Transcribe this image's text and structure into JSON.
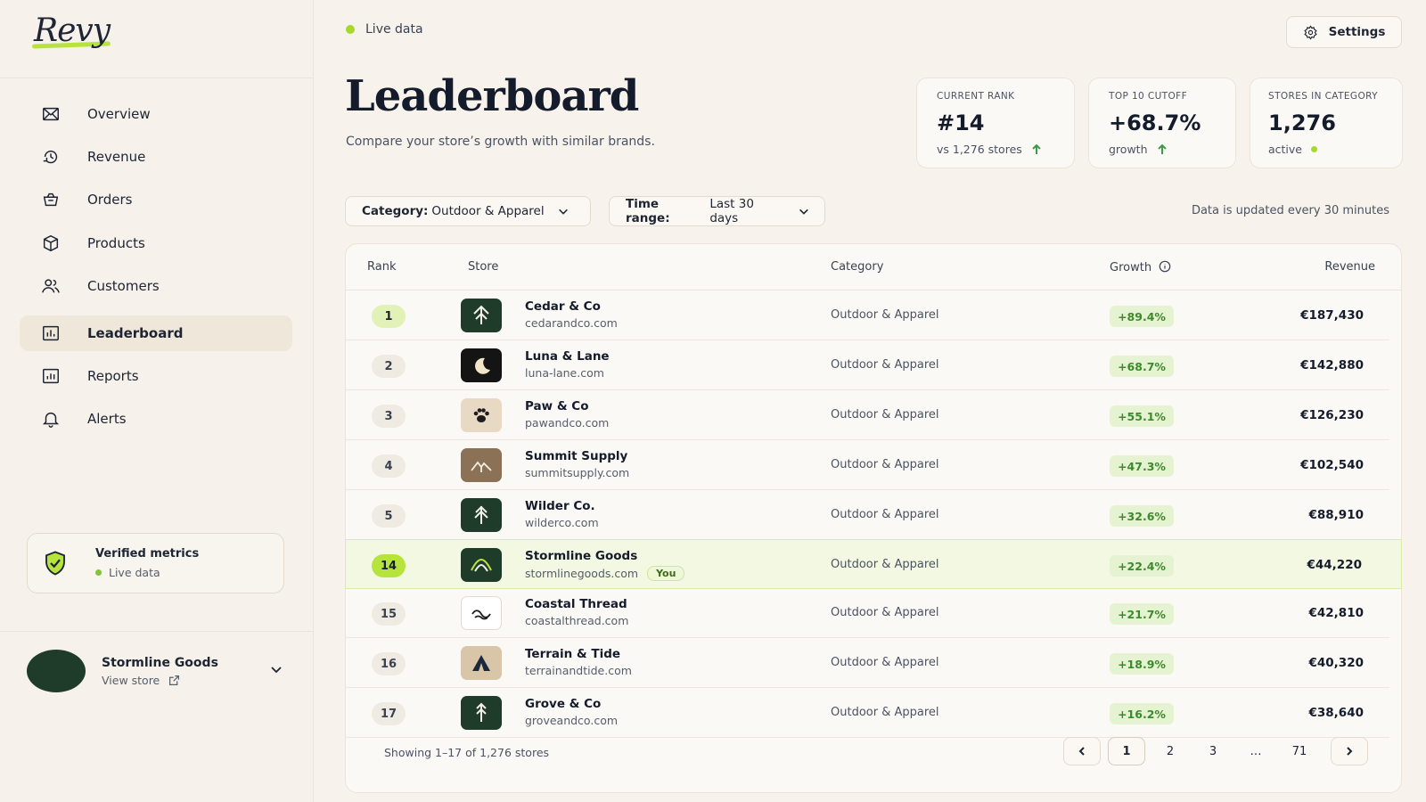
{
  "brand": {
    "logo_text": "Revy"
  },
  "nav": [
    {
      "label": "Overview",
      "icon": "mail-icon"
    },
    {
      "label": "Revenue",
      "icon": "revenue-icon"
    },
    {
      "label": "Orders",
      "icon": "basket-icon"
    },
    {
      "label": "Products",
      "icon": "box-icon"
    },
    {
      "label": "Customers",
      "icon": "users-icon"
    },
    {
      "label": "Leaderboard",
      "icon": "leaderboard-icon",
      "active": true
    },
    {
      "label": "Reports",
      "icon": "reports-icon"
    },
    {
      "label": "Alerts",
      "icon": "bell-icon"
    }
  ],
  "verified": {
    "title": "Verified metrics",
    "status": "Live data"
  },
  "account": {
    "name": "Stormline Goods",
    "link": "View store"
  },
  "header": {
    "live_label": "Live data",
    "settings_label": "Settings"
  },
  "page": {
    "title": "Leaderboard",
    "subtitle": "Compare your store’s growth with similar brands."
  },
  "kpis": [
    {
      "label": "Current rank",
      "value": "#14",
      "sub": "vs 1,276 stores"
    },
    {
      "label": "Top 10 cutoff",
      "value": "+68.7%",
      "sub": "growth"
    },
    {
      "label": "Stores in category",
      "value": "1,276",
      "sub": "active"
    }
  ],
  "filters": {
    "category_key": "Category:",
    "category_value": "Outdoor & Apparel",
    "time_key": "Time range:",
    "time_value": "Last 30 days",
    "update_note": "Data is updated every 30 minutes"
  },
  "table": {
    "headers": {
      "rank": "Rank",
      "store": "Store",
      "category": "Category",
      "growth": "Growth",
      "revenue": "Revenue"
    },
    "you_badge": "You",
    "rows": [
      {
        "rank": "1",
        "name": "Cedar & Co",
        "domain": "cedarandco.com",
        "category": "Outdoor & Apparel",
        "growth": "+89.4%",
        "revenue": "€187,430",
        "logo": "tree-icon"
      },
      {
        "rank": "2",
        "name": "Luna & Lane",
        "domain": "luna-lane.com",
        "category": "Outdoor & Apparel",
        "growth": "+68.7%",
        "revenue": "€142,880",
        "logo": "moon-icon"
      },
      {
        "rank": "3",
        "name": "Paw & Co",
        "domain": "pawandco.com",
        "category": "Outdoor & Apparel",
        "growth": "+55.1%",
        "revenue": "€126,230",
        "logo": "paw-icon"
      },
      {
        "rank": "4",
        "name": "Summit Supply",
        "domain": "summitsupply.com",
        "category": "Outdoor & Apparel",
        "growth": "+47.3%",
        "revenue": "€102,540",
        "logo": "mountain-icon"
      },
      {
        "rank": "5",
        "name": "Wilder Co.",
        "domain": "wilderco.com",
        "category": "Outdoor & Apparel",
        "growth": "+32.6%",
        "revenue": "€88,910",
        "logo": "pine-icon"
      },
      {
        "rank": "14",
        "name": "Stormline Goods",
        "domain": "stormlinegoods.com",
        "category": "Outdoor & Apparel",
        "growth": "+22.4%",
        "revenue": "€44,220",
        "logo": "arc-icon",
        "you": true
      },
      {
        "rank": "15",
        "name": "Coastal Thread",
        "domain": "coastalthread.com",
        "category": "Outdoor & Apparel",
        "growth": "+21.7%",
        "revenue": "€42,810",
        "logo": "wave-icon"
      },
      {
        "rank": "16",
        "name": "Terrain & Tide",
        "domain": "terrainandtide.com",
        "category": "Outdoor & Apparel",
        "growth": "+18.9%",
        "revenue": "€40,320",
        "logo": "tent-icon"
      },
      {
        "rank": "17",
        "name": "Grove & Co",
        "domain": "groveandco.com",
        "category": "Outdoor & Apparel",
        "growth": "+16.2%",
        "revenue": "€38,640",
        "logo": "arrow-tree-icon"
      }
    ]
  },
  "pagination": {
    "showing": "Showing 1–17 of 1,276 stores",
    "pages": [
      "1",
      "2",
      "3",
      "…",
      "71"
    ]
  },
  "colors": {
    "accent": "#b7e33d",
    "forest": "#1f3b2a",
    "growth_text": "#3d8a2c"
  }
}
